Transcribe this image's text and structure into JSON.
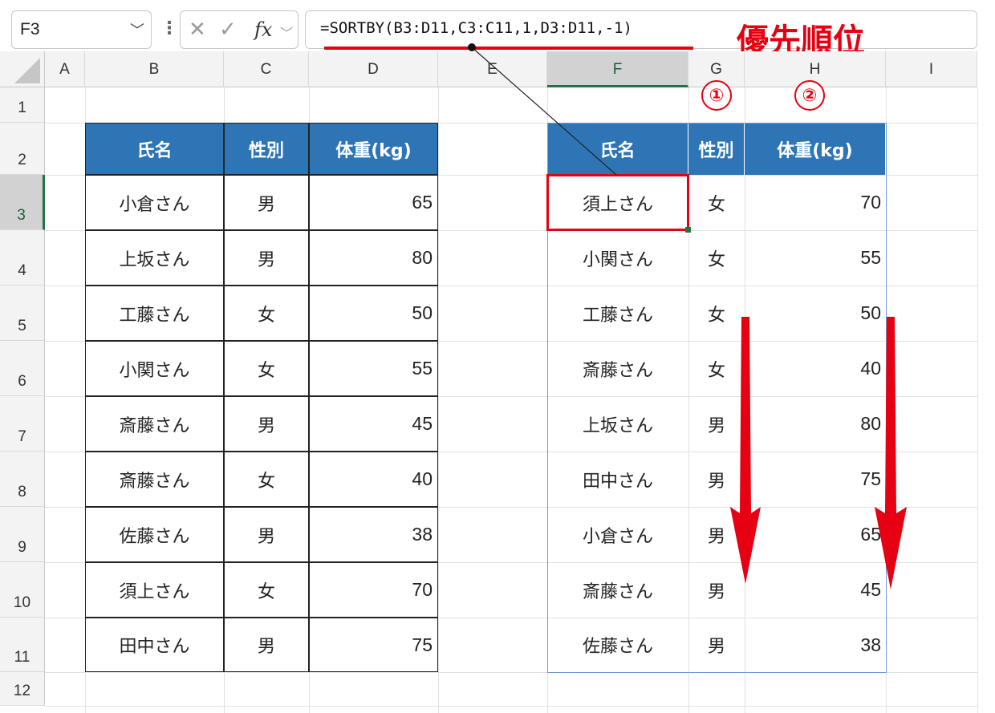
{
  "formula_bar": {
    "name_box": "F3",
    "cancel_icon": "✕",
    "enter_icon": "✓",
    "fx_label": "fx",
    "formula": "=SORTBY(B3:D11,C3:C11,1,D3:D11,-1)"
  },
  "annotation": {
    "title": "優先順位",
    "marker1": "①",
    "marker2": "②",
    "color": "#e60012"
  },
  "columns": [
    "A",
    "B",
    "C",
    "D",
    "E",
    "F",
    "G",
    "H",
    "I"
  ],
  "rows": [
    "1",
    "2",
    "3",
    "4",
    "5",
    "6",
    "7",
    "8",
    "9",
    "10",
    "11",
    "12"
  ],
  "source_table": {
    "headers": [
      "氏名",
      "性別",
      "体重(kg)"
    ],
    "rows": [
      [
        "小倉さん",
        "男",
        "65"
      ],
      [
        "上坂さん",
        "男",
        "80"
      ],
      [
        "工藤さん",
        "女",
        "50"
      ],
      [
        "小関さん",
        "女",
        "55"
      ],
      [
        "斎藤さん",
        "男",
        "45"
      ],
      [
        "斎藤さん",
        "女",
        "40"
      ],
      [
        "佐藤さん",
        "男",
        "38"
      ],
      [
        "須上さん",
        "女",
        "70"
      ],
      [
        "田中さん",
        "男",
        "75"
      ]
    ]
  },
  "result_table": {
    "headers": [
      "氏名",
      "性別",
      "体重(kg)"
    ],
    "rows": [
      [
        "須上さん",
        "女",
        "70"
      ],
      [
        "小関さん",
        "女",
        "55"
      ],
      [
        "工藤さん",
        "女",
        "50"
      ],
      [
        "斎藤さん",
        "女",
        "40"
      ],
      [
        "上坂さん",
        "男",
        "80"
      ],
      [
        "田中さん",
        "男",
        "75"
      ],
      [
        "小倉さん",
        "男",
        "65"
      ],
      [
        "斎藤さん",
        "男",
        "45"
      ],
      [
        "佐藤さん",
        "男",
        "38"
      ]
    ]
  },
  "colors": {
    "header_fill": "#2e75b6",
    "selection": "#217346",
    "accent": "#e60012"
  }
}
